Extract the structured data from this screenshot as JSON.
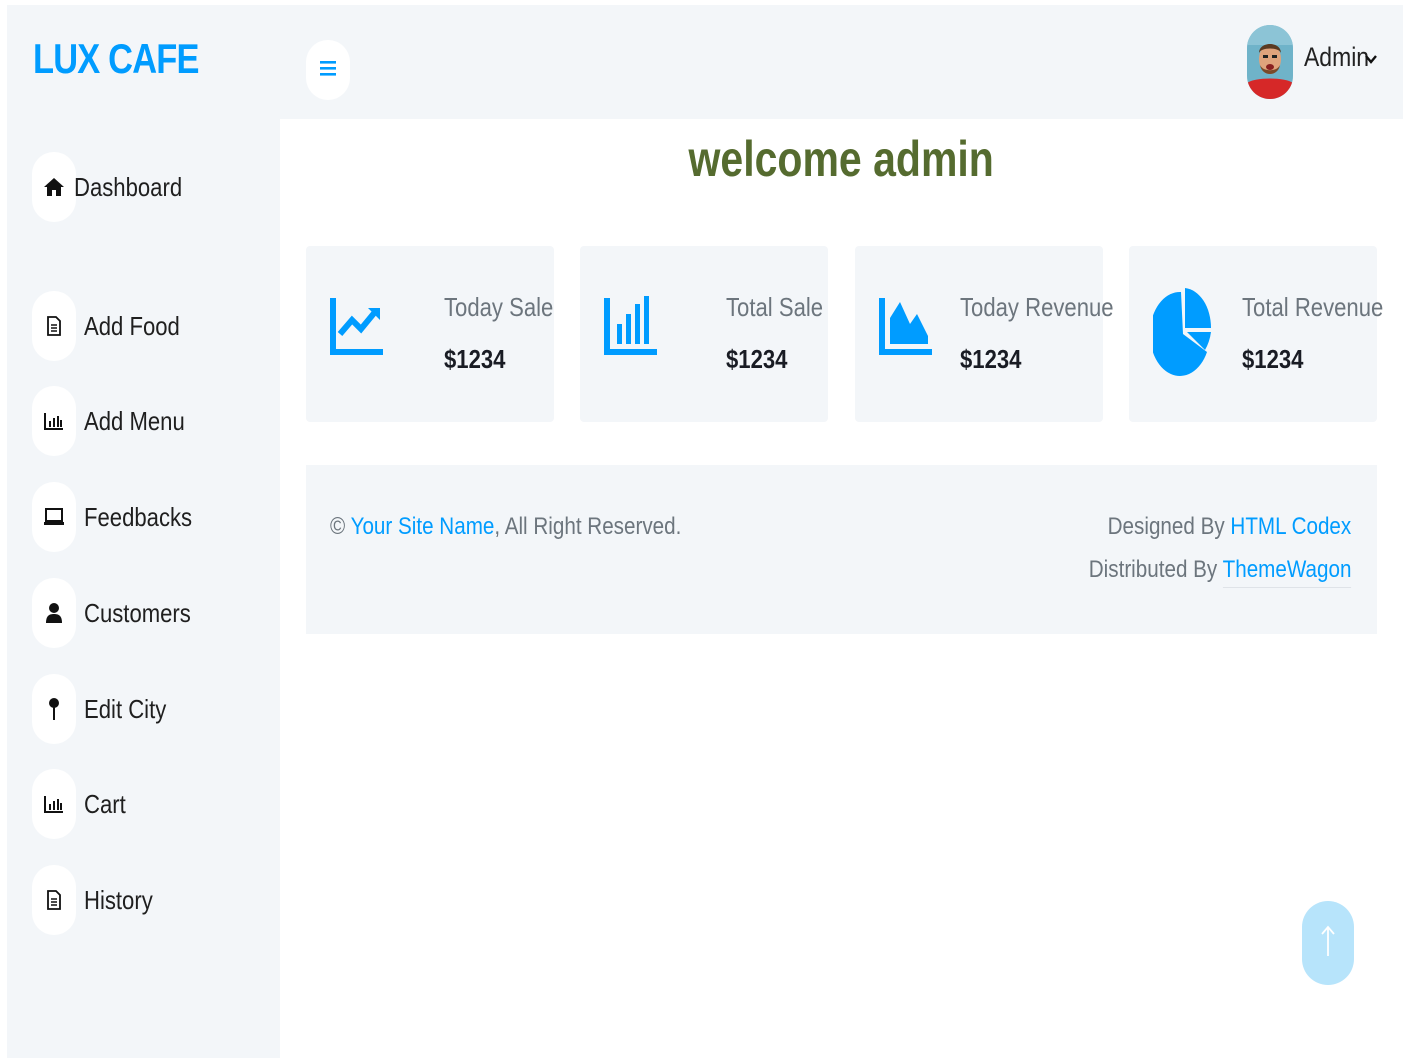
{
  "brand": {
    "name": "LUX CAFE",
    "color": "#009CFF"
  },
  "sidebar": {
    "items": [
      {
        "label": "Dashboard",
        "icon": "home-icon"
      },
      {
        "label": "Add Food",
        "icon": "file-icon"
      },
      {
        "label": "Add Menu",
        "icon": "bar-chart-icon"
      },
      {
        "label": "Feedbacks",
        "icon": "laptop-icon"
      },
      {
        "label": "Customers",
        "icon": "user-icon"
      },
      {
        "label": "Edit City",
        "icon": "map-pin-icon"
      },
      {
        "label": "Cart",
        "icon": "bar-chart-icon"
      },
      {
        "label": "History",
        "icon": "file-icon"
      }
    ]
  },
  "header": {
    "menu_icon": "hamburger-icon",
    "user_name": "Admin",
    "user_caret": "chevron-down-icon"
  },
  "main": {
    "welcome": "welcome admin",
    "welcome_color": "#556B2F",
    "cards": [
      {
        "title": "Today Sale",
        "value": "$1234",
        "icon": "line-chart-icon"
      },
      {
        "title": "Total Sale",
        "value": "$1234",
        "icon": "bar-chart-icon"
      },
      {
        "title": "Today Revenue",
        "value": "$1234",
        "icon": "area-chart-icon"
      },
      {
        "title": "Total Revenue",
        "value": "$1234",
        "icon": "pie-chart-icon"
      }
    ]
  },
  "footer": {
    "copyright_symbol": "©",
    "site_name": "Your Site Name",
    "rights": ", All Right Reserved.",
    "designed_by": "Designed By",
    "designer": "HTML Codex",
    "distributed_by": "Distributed By",
    "distributor": "ThemeWagon"
  },
  "back_to_top": {
    "icon": "arrow-up-icon"
  }
}
